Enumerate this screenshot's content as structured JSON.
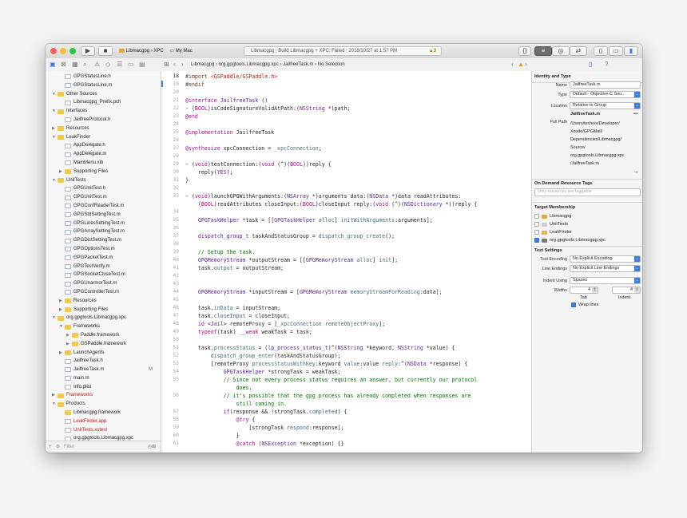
{
  "titlebar": {
    "scheme": "Libmacgpg › XPC",
    "destination": "My Mac",
    "activity_project": "Libmacgpg",
    "activity_status": "Build Libmacgpg + XPC: Failed",
    "activity_date": "2018/10/27 at 1:57 PM",
    "warning_count": "3",
    "colors": {
      "close": "#fd5f57",
      "minimize": "#febc2e",
      "zoom": "#28c840",
      "accent": "#3a7ee0"
    }
  },
  "jumpbar": {
    "path": "Libmacgpg › org.gpgtools.Libmacgpg.xpc › JailfreeTask.m › No Selection"
  },
  "navigator": {
    "filter_placeholder": "Filter",
    "items": [
      {
        "label": "GPGStatusLine.h",
        "indent": 2,
        "kind": "h"
      },
      {
        "label": "GPGStatusLine.m",
        "indent": 2,
        "kind": "m"
      },
      {
        "label": "Other Sources",
        "indent": 1,
        "kind": "folder",
        "disclosure": "▼"
      },
      {
        "label": "Libmacgpg_Prefix.pch",
        "indent": 2,
        "kind": "h"
      },
      {
        "label": "Interfaces",
        "indent": 1,
        "kind": "folder",
        "disclosure": "▼"
      },
      {
        "label": "JailfreeProtocol.h",
        "indent": 2,
        "kind": "h"
      },
      {
        "label": "Resources",
        "indent": 1,
        "kind": "folder",
        "disclosure": "▶"
      },
      {
        "label": "LeakFinder",
        "indent": 1,
        "kind": "folder",
        "disclosure": "▼"
      },
      {
        "label": "AppDelegate.h",
        "indent": 2,
        "kind": "h"
      },
      {
        "label": "AppDelegate.m",
        "indent": 2,
        "kind": "m"
      },
      {
        "label": "MainMenu.xib",
        "indent": 2,
        "kind": "h"
      },
      {
        "label": "Supporting Files",
        "indent": 2,
        "kind": "folder",
        "disclosure": "▶"
      },
      {
        "label": "UnitTests",
        "indent": 1,
        "kind": "folder",
        "disclosure": "▼"
      },
      {
        "label": "GPGUnitTest.h",
        "indent": 2,
        "kind": "h"
      },
      {
        "label": "GPGUnitTest.m",
        "indent": 2,
        "kind": "m"
      },
      {
        "label": "GPGConfReaderTest.m",
        "indent": 2,
        "kind": "m"
      },
      {
        "label": "GPGStdSettingTest.m",
        "indent": 2,
        "kind": "m"
      },
      {
        "label": "GPGLinesSettingTest.m",
        "indent": 2,
        "kind": "m"
      },
      {
        "label": "GPGArraySettingTest.m",
        "indent": 2,
        "kind": "m"
      },
      {
        "label": "GPGDictSettingTest.m",
        "indent": 2,
        "kind": "m"
      },
      {
        "label": "GPGOptionsTest.m",
        "indent": 2,
        "kind": "m"
      },
      {
        "label": "GPGPacketTest.m",
        "indent": 2,
        "kind": "m"
      },
      {
        "label": "GPGTestVerify.m",
        "indent": 2,
        "kind": "m"
      },
      {
        "label": "GPGSocketCloseTest.m",
        "indent": 2,
        "kind": "m"
      },
      {
        "label": "GPGUnarmorTest.m",
        "indent": 2,
        "kind": "m"
      },
      {
        "label": "GPGControllerTest.m",
        "indent": 2,
        "kind": "m"
      },
      {
        "label": "Resources",
        "indent": 2,
        "kind": "folder",
        "disclosure": "▶"
      },
      {
        "label": "Supporting Files",
        "indent": 2,
        "kind": "folder",
        "disclosure": "▶"
      },
      {
        "label": "org.gpgtools.Libmacgpg.xpc",
        "indent": 1,
        "kind": "folder",
        "disclosure": "▼"
      },
      {
        "label": "Frameworks",
        "indent": 2,
        "kind": "folder",
        "disclosure": "▼"
      },
      {
        "label": "Paddle.framework",
        "indent": 3,
        "kind": "folder",
        "disclosure": "▶"
      },
      {
        "label": "GSPaddle.framework",
        "indent": 3,
        "kind": "folder",
        "disclosure": "▶"
      },
      {
        "label": "LaunchAgents",
        "indent": 2,
        "kind": "folder",
        "disclosure": "▶"
      },
      {
        "label": "JailfreeTask.h",
        "indent": 2,
        "kind": "h"
      },
      {
        "label": "JailfreeTask.m",
        "indent": 2,
        "kind": "m",
        "badge": "M"
      },
      {
        "label": "main.m",
        "indent": 2,
        "kind": "m"
      },
      {
        "label": "Info.plist",
        "indent": 2,
        "kind": "h"
      },
      {
        "label": "Frameworks",
        "indent": 1,
        "kind": "folder",
        "disclosure": "▶",
        "color": "#c41a16"
      },
      {
        "label": "Products",
        "indent": 1,
        "kind": "folder",
        "disclosure": "▼"
      },
      {
        "label": "Libmacgpg.framework",
        "indent": 2,
        "kind": "folder"
      },
      {
        "label": "LeakFinder.app",
        "indent": 2,
        "kind": "h",
        "color": "#c41a16"
      },
      {
        "label": "UnitTests.xctest",
        "indent": 2,
        "kind": "h",
        "color": "#c41a16"
      },
      {
        "label": "org.gpgtools.Libmacgpg.xpc",
        "indent": 2,
        "kind": "h"
      }
    ]
  },
  "editor": {
    "lines": [
      {
        "n": "18",
        "html": "<span class='c-pp'>#import </span><span class='c-st'>&lt;GSPaddle/GSPaddle.h&gt;</span>"
      },
      {
        "n": "19",
        "html": "<span class='c-pp'>#endif</span>"
      },
      {
        "n": "20",
        "html": ""
      },
      {
        "n": "21",
        "html": "<span class='c-kw'>@interface</span> <span class='c-ty'>JailfreeTask</span> ()"
      },
      {
        "n": "22",
        "html": "- (<span class='c-kw'>BOOL</span>)isCodeSignatureValidAtPath:(<span class='c-ty'>NSString</span> *)path;"
      },
      {
        "n": "23",
        "html": "<span class='c-kw'>@end</span>"
      },
      {
        "n": "24",
        "html": ""
      },
      {
        "n": "25",
        "html": "<span class='c-kw'>@implementation</span> JailfreeTask"
      },
      {
        "n": "26",
        "html": ""
      },
      {
        "n": "27",
        "html": "<span class='c-kw'>@synthesize</span> xpcConnection = <span class='c-fn'>_xpcConnection</span>;"
      },
      {
        "n": "28",
        "html": ""
      },
      {
        "n": "29",
        "html": "- (<span class='c-kw'>void</span>)testConnection:(<span class='c-kw'>void</span> (^)(<span class='c-kw'>BOOL</span>))reply {"
      },
      {
        "n": "30",
        "html": "    reply(<span class='c-kw'>YES</span>);"
      },
      {
        "n": "31",
        "html": "}"
      },
      {
        "n": "32",
        "html": ""
      },
      {
        "n": "33",
        "html": "- (<span class='c-kw'>void</span>)launchGPGWithArguments:(<span class='c-ty'>NSArray</span> *)arguments data:(<span class='c-ty'>NSData</span> *)data readAttributes:"
      },
      {
        "n": "",
        "html": "    (<span class='c-kw'>BOOL</span>)readAttributes closeInput:(<span class='c-kw'>BOOL</span>)closeInput reply:(<span class='c-kw'>void</span> (^)(<span class='c-ty'>NSDictionary</span> *))reply {"
      },
      {
        "n": "34",
        "html": ""
      },
      {
        "n": "35",
        "html": "    <span class='c-ty'>GPGTaskHelper</span> *task = [[<span class='c-ty'>GPGTaskHelper</span> <span class='c-fn'>alloc</span>] <span class='c-fn'>initWithArguments</span>:arguments];"
      },
      {
        "n": "36",
        "html": ""
      },
      {
        "n": "37",
        "html": "    <span class='c-ty'>dispatch_group_t</span> taskAndStatusGroup = <span class='c-fn'>dispatch_group_create</span>();"
      },
      {
        "n": "38",
        "html": ""
      },
      {
        "n": "39",
        "html": "    <span class='c-cm'>// Setup the task.</span>"
      },
      {
        "n": "40",
        "html": "    <span class='c-ty'>GPGMemoryStream</span> *outputStream = [[<span class='c-ty'>GPGMemoryStream</span> <span class='c-fn'>alloc</span>] <span class='c-fn'>init</span>];"
      },
      {
        "n": "41",
        "html": "    task.<span class='c-fn'>output</span> = outputStream;"
      },
      {
        "n": "42",
        "html": ""
      },
      {
        "n": "43",
        "html": ""
      },
      {
        "n": "44",
        "html": "    <span class='c-ty'>GPGMemoryStream</span> *inputStream = [<span class='c-ty'>GPGMemoryStream</span> <span class='c-fn'>memoryStreamForReading</span>:data];"
      },
      {
        "n": "45",
        "html": ""
      },
      {
        "n": "46",
        "html": "    task.<span class='c-fn'>inData</span> = inputStream;"
      },
      {
        "n": "47",
        "html": "    task.<span class='c-fn'>closeInput</span> = closeInput;"
      },
      {
        "n": "48",
        "html": "    <span class='c-kw'>id</span> &lt;<span class='c-ty'>Jail</span>&gt; remoteProxy = [<span class='c-fn'>_xpcConnection</span> <span class='c-fn'>remoteObjectProxy</span>];"
      },
      {
        "n": "49",
        "html": "    <span class='c-kw'>typeof</span>(task) <span class='c-kw'>__weak</span> weakTask = task;"
      },
      {
        "n": "50",
        "html": ""
      },
      {
        "n": "51",
        "html": "    task.<span class='c-fn'>processStatus</span> = (<span class='c-ty'>lp_process_status_t</span>)^(<span class='c-ty'>NSString</span> *keyword, <span class='c-ty'>NSString</span> *value) {"
      },
      {
        "n": "52",
        "html": "        <span class='c-fn'>dispatch_group_enter</span>(taskAndStatusGroup);"
      },
      {
        "n": "53",
        "html": "        [remoteProxy <span class='c-fn'>processStatusWithKey</span>:keyword <span class='c-fn'>value</span>:value <span class='c-fn'>reply</span>:^(<span class='c-ty'>NSData</span> *response) {"
      },
      {
        "n": "54",
        "html": "            <span class='c-ty'>GPGTaskHelper</span> *strongTask = weakTask;"
      },
      {
        "n": "55",
        "html": "            <span class='c-cm'>// Since not every process status requires an answer, but currently our protocol</span>"
      },
      {
        "n": "",
        "html": "                <span class='c-cm'>does,</span>"
      },
      {
        "n": "56",
        "html": "            <span class='c-cm'>// it's possible that the gpg process has already completed when responses are</span>"
      },
      {
        "n": "",
        "html": "                <span class='c-cm'>still coming in.</span>"
      },
      {
        "n": "57",
        "html": "            <span class='c-kw'>if</span>(response &amp;&amp; !strongTask.<span class='c-fn'>completed</span>) {"
      },
      {
        "n": "58",
        "html": "                <span class='c-kw'>@try</span> {"
      },
      {
        "n": "59",
        "html": "                    [strongTask <span class='c-fn'>respond</span>:response];"
      },
      {
        "n": "60",
        "html": "                }"
      },
      {
        "n": "61",
        "html": "                <span class='c-kw'>@catch</span> (<span class='c-ty'>NSException</span> *exception) {}"
      }
    ]
  },
  "inspector": {
    "identity": {
      "title": "Identity and Type",
      "name_label": "Name",
      "name_value": "JailfreeTask.m",
      "type_label": "Type",
      "type_value": "Default - Objective-C Sou...",
      "location_label": "Location",
      "location_value": "Relative to Group",
      "location_file": "JailfreeTask.m",
      "fullpath_label": "Full Path",
      "fullpath_value": [
        "/Users/technix/Developer/",
        "Xcode/GPGMail/",
        "Dependencies/Libmacgpg/",
        "Source/",
        "org.gpgtools.Libmacgpg.xpc",
        "/JailfreeTask.m"
      ]
    },
    "ondemand": {
      "title": "On Demand Resource Tags",
      "placeholder": "Only resources are taggable"
    },
    "membership": {
      "title": "Target Membership",
      "targets": [
        {
          "label": "Libmacgpg",
          "checked": false
        },
        {
          "label": "UnitTests",
          "checked": false
        },
        {
          "label": "LeakFinder",
          "checked": false
        },
        {
          "label": "org.gpgtools.Libmacgpg.xpc",
          "checked": true
        }
      ]
    },
    "text": {
      "title": "Text Settings",
      "encoding_label": "Text Encoding",
      "encoding_value": "No Explicit Encoding",
      "endings_label": "Line Endings",
      "endings_value": "No Explicit Line Endings",
      "indent_label": "Indent Using",
      "indent_value": "Spaces",
      "widths_label": "Widths",
      "tab_value": "4",
      "indent_width_value": "4",
      "tab_label": "Tab",
      "indent_sub_label": "Indent",
      "wrap_label": "Wrap lines"
    }
  }
}
